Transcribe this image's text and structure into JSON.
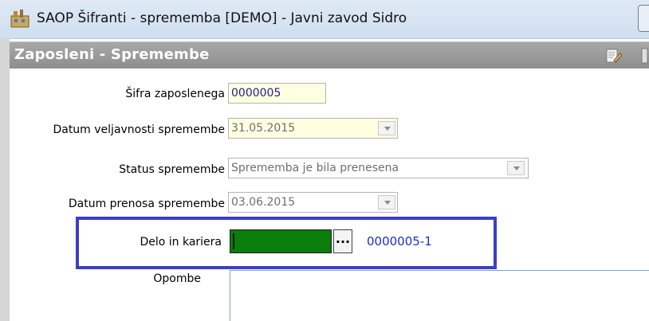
{
  "window": {
    "title": "SAOP Šifranti - sprememba [DEMO] - Javni zavod Sidro",
    "app_icon": "saop-app-icon"
  },
  "panel": {
    "title": "Zaposleni - Spremembe",
    "edit_icon": "edit-document-icon"
  },
  "form": {
    "employee_code": {
      "label": "Šifra zaposlenega",
      "value": "0000005"
    },
    "valid_date": {
      "label": "Datum veljavnosti spremembe",
      "value": "31.05.2015"
    },
    "status": {
      "label": "Status spremembe",
      "value": "Sprememba je bila prenesena"
    },
    "transfer_date": {
      "label": "Datum prenosa spremembe",
      "value": "03.06.2015"
    },
    "career": {
      "label": "Delo in kariera",
      "value": "",
      "button_label": "...",
      "link_code": "0000005-1"
    },
    "notes": {
      "label": "Opombe",
      "value": ""
    }
  },
  "colors": {
    "highlight_border": "#3b3fc4",
    "career_input_fill": "#0a7d0a",
    "link_text": "#1d2bd6",
    "readonly_field_bg": "#ffffe1"
  }
}
